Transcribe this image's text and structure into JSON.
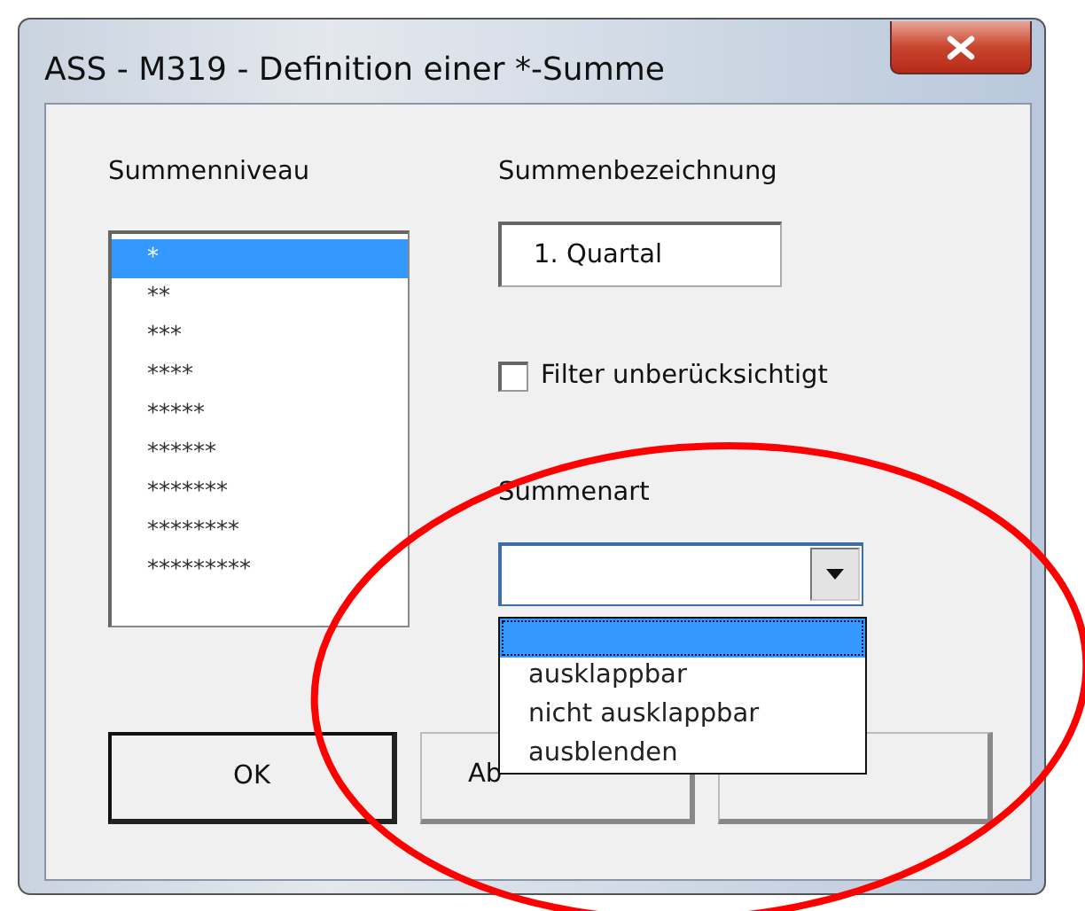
{
  "window": {
    "title": "ASS - M319 - Definition einer *-Summe"
  },
  "level_list": {
    "label": "Summenniveau",
    "items": [
      {
        "text": "*",
        "selected": true
      },
      {
        "text": "**",
        "selected": false
      },
      {
        "text": "***",
        "selected": false
      },
      {
        "text": "****",
        "selected": false
      },
      {
        "text": "*****",
        "selected": false
      },
      {
        "text": "******",
        "selected": false
      },
      {
        "text": "*******",
        "selected": false
      },
      {
        "text": "********",
        "selected": false
      },
      {
        "text": "*********",
        "selected": false
      }
    ]
  },
  "name_field": {
    "label": "Summenbezeichnung",
    "value": "1. Quartal"
  },
  "filter_checkbox": {
    "label": "Filter unberücksichtigt",
    "checked": false
  },
  "type_combo": {
    "label": "Summenart",
    "expanded": true,
    "options": [
      {
        "selected": true
      },
      {
        "text": "ausklappbar",
        "selected": false
      },
      {
        "text": "nicht ausklappbar",
        "selected": false
      },
      {
        "text": "ausblenden",
        "selected": false
      }
    ]
  },
  "buttons": [
    {
      "label": "OK",
      "default": true
    },
    {
      "label": "Ab",
      "default": false
    },
    {
      "default": false
    }
  ],
  "annotations": [
    {
      "kind": "ellipse",
      "color": "#ff0000"
    }
  ]
}
